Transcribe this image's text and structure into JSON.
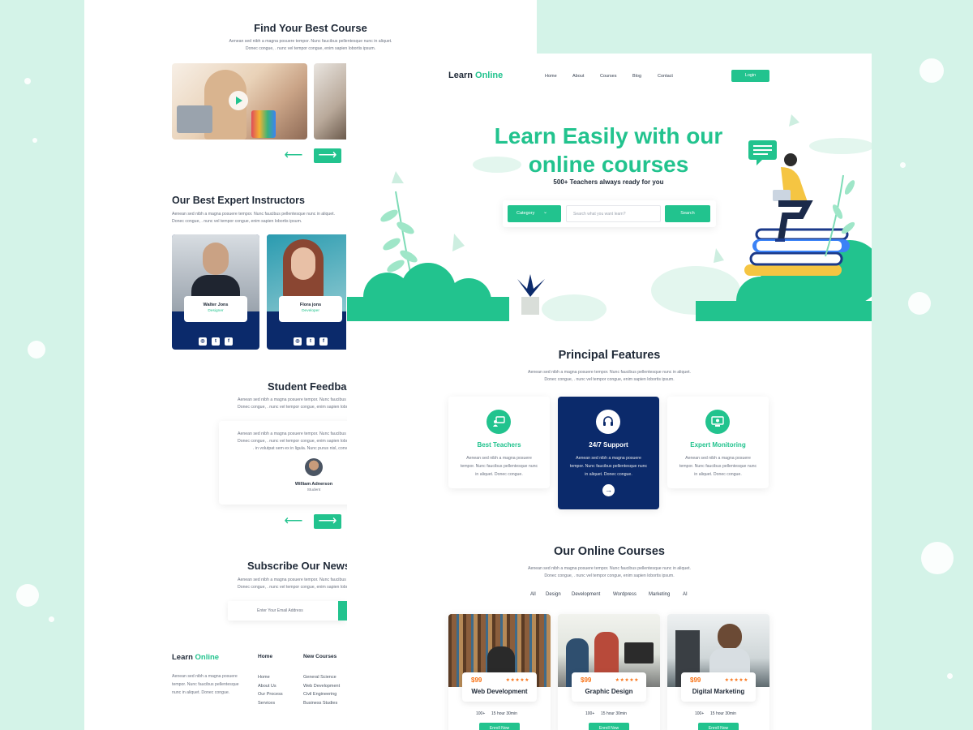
{
  "back_page": {
    "find_course": {
      "title": "Find Your Best Course",
      "desc_line1": "Aenean sed nibh a magna posuere tempor. Nunc faucibus pellentesque nunc in aliquet.",
      "desc_line2": "Donec congue, . nunc vel tempor congue, enim sapien lobortis ipsum."
    },
    "instructors": {
      "title": "Our Best Expert Instructors",
      "desc_line1": "Aenean sed nibh a magna posuere tempor. Nunc faucibus pellentesque nunc in aliquet.",
      "desc_line2": "Donec congue, . nunc vel tempor congue, enim sapien lobortis ipsum.",
      "people": [
        {
          "name": "Walter Jons",
          "role": "Designer"
        },
        {
          "name": "Flora jons",
          "role": "Developer"
        }
      ]
    },
    "feedback": {
      "title": "Student Feedbac",
      "desc_line1": "Aenean sed nibh a magna posuere tempor. Nunc faucibus pellentesque nunc in aliquet.",
      "desc_line2": "Donec congue, . nunc vel tempor congue, enim sapien lobortis ipsum.",
      "quote_line1": "Aenean sed nibh a magna posuere tempor. Nunc faucibus pellentesque nunc",
      "quote_line2": "Donec congue, . nunc vel tempor congue, enim sapien lobortis ipsum. Donec",
      "quote_line3": ". in volutpat sem ex in ligula. Nunc purus nisl, convallis",
      "name": "William Adnerson",
      "role": "Student"
    },
    "newsletter": {
      "title": "Subscribe Our Newsl",
      "desc_line1": "Aenean sed nibh a magna posuere tempor. Nunc faucibus pellentesque nunc in aliquet.",
      "desc_line2": "Donec congue, . nunc vel tempor congue, enim sapien lobortis ipsum.",
      "placeholder": "Enter Your Email Address"
    },
    "footer": {
      "brand_a": "Learn",
      "brand_b": "Online",
      "about_line1": "Aenean sed nibh a magna posuere",
      "about_line2": "tempor. Nunc faucibus pellentesque",
      "about_line3": "nunc in aliquet. Donec congue.",
      "col1_title": "Home",
      "col1_items": [
        "Home",
        "About Us",
        "Our Process",
        "Services"
      ],
      "col2_title": "New Courses",
      "col2_items": [
        "General Science",
        "Web Development",
        "Civil Engineering",
        "Business Studies"
      ]
    }
  },
  "front_page": {
    "brand_a": "Learn",
    "brand_b": "Online",
    "nav": [
      "Home",
      "About",
      "Courses",
      "Blog",
      "Contact"
    ],
    "login": "Login",
    "hero": {
      "line1": "Learn Easily with our",
      "line2": "online courses",
      "subtitle": "500+ Teachers always ready for you",
      "category": "Category",
      "search_placeholder": "Search what you want learn?",
      "search_button": "Search"
    },
    "features": {
      "title": "Principal Features",
      "desc_line1": "Aenean sed nibh a magna posuere tempor. Nunc faucibus pellentesque nunc in aliquet.",
      "desc_line2": "Donec congue, . nunc vel tempor congue, enim sapien lobortis ipsum.",
      "cards": [
        {
          "title": "Best Teachers",
          "l1": "Aenean sed nibh a magna posuere",
          "l2": "tempor. Nunc faucibus pellentesque nunc",
          "l3": "in aliquet. Donec congue."
        },
        {
          "title": "24/7 Support",
          "l1": "Aenean sed nibh a magna posuere",
          "l2": "tempor. Nunc faucibus pellentesque nunc",
          "l3": "in aliquet. Donec congue."
        },
        {
          "title": "Expert Monitoring",
          "l1": "Aenean sed nibh a magna posuere",
          "l2": "tempor. Nunc faucibus pellentesque nunc",
          "l3": "in aliquet. Donec congue."
        }
      ]
    },
    "courses": {
      "title": "Our Online Courses",
      "desc_line1": "Aenean sed nibh a magna posuere tempor. Nunc faucibus pellentesque nunc in aliquet.",
      "desc_line2": "Donec congue, . nunc vel tempor congue, enim sapien lobortis ipsum.",
      "tabs": [
        "All",
        "Design",
        "Development",
        "Wordpress",
        "Marketing",
        "AI"
      ],
      "items": [
        {
          "price": "$99",
          "stars": "★★★★★",
          "name": "Web Development",
          "students": "100+",
          "duration": "15 hour 30min",
          "enroll": "Enroll Now"
        },
        {
          "price": "$99",
          "stars": "★★★★★",
          "name": "Graphic Design",
          "students": "100+",
          "duration": "15 hour 30min",
          "enroll": "Enroll Now"
        },
        {
          "price": "$99",
          "stars": "★★★★★",
          "name": "Digital Marketing",
          "students": "100+",
          "duration": "15 hour 30min",
          "enroll": "Enroll Now"
        }
      ]
    }
  },
  "colors": {
    "accent": "#22c38e",
    "navy": "#0b2a6b",
    "background": "#d4f3e8",
    "star": "#f97316"
  }
}
